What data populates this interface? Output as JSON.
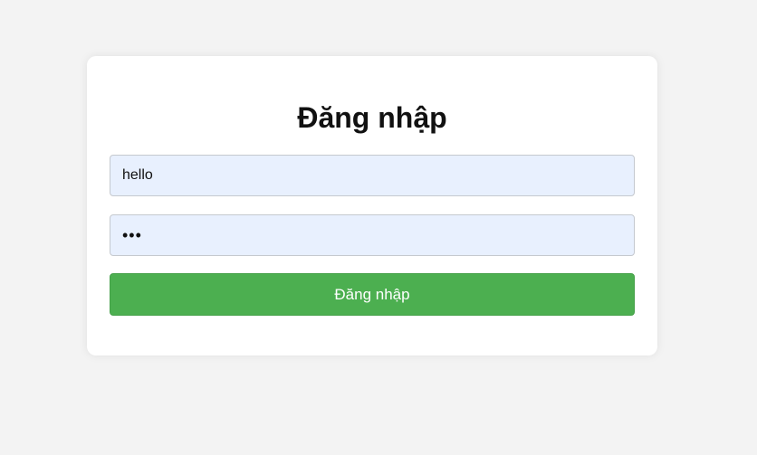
{
  "login_form": {
    "title": "Đăng nhập",
    "username_value": "hello",
    "password_value": "abc",
    "submit_label": "Đăng nhập"
  },
  "colors": {
    "page_background": "#f3f3f3",
    "card_background": "#ffffff",
    "input_background": "#e8f0fe",
    "button_background": "#4caf50",
    "button_text": "#ffffff"
  }
}
